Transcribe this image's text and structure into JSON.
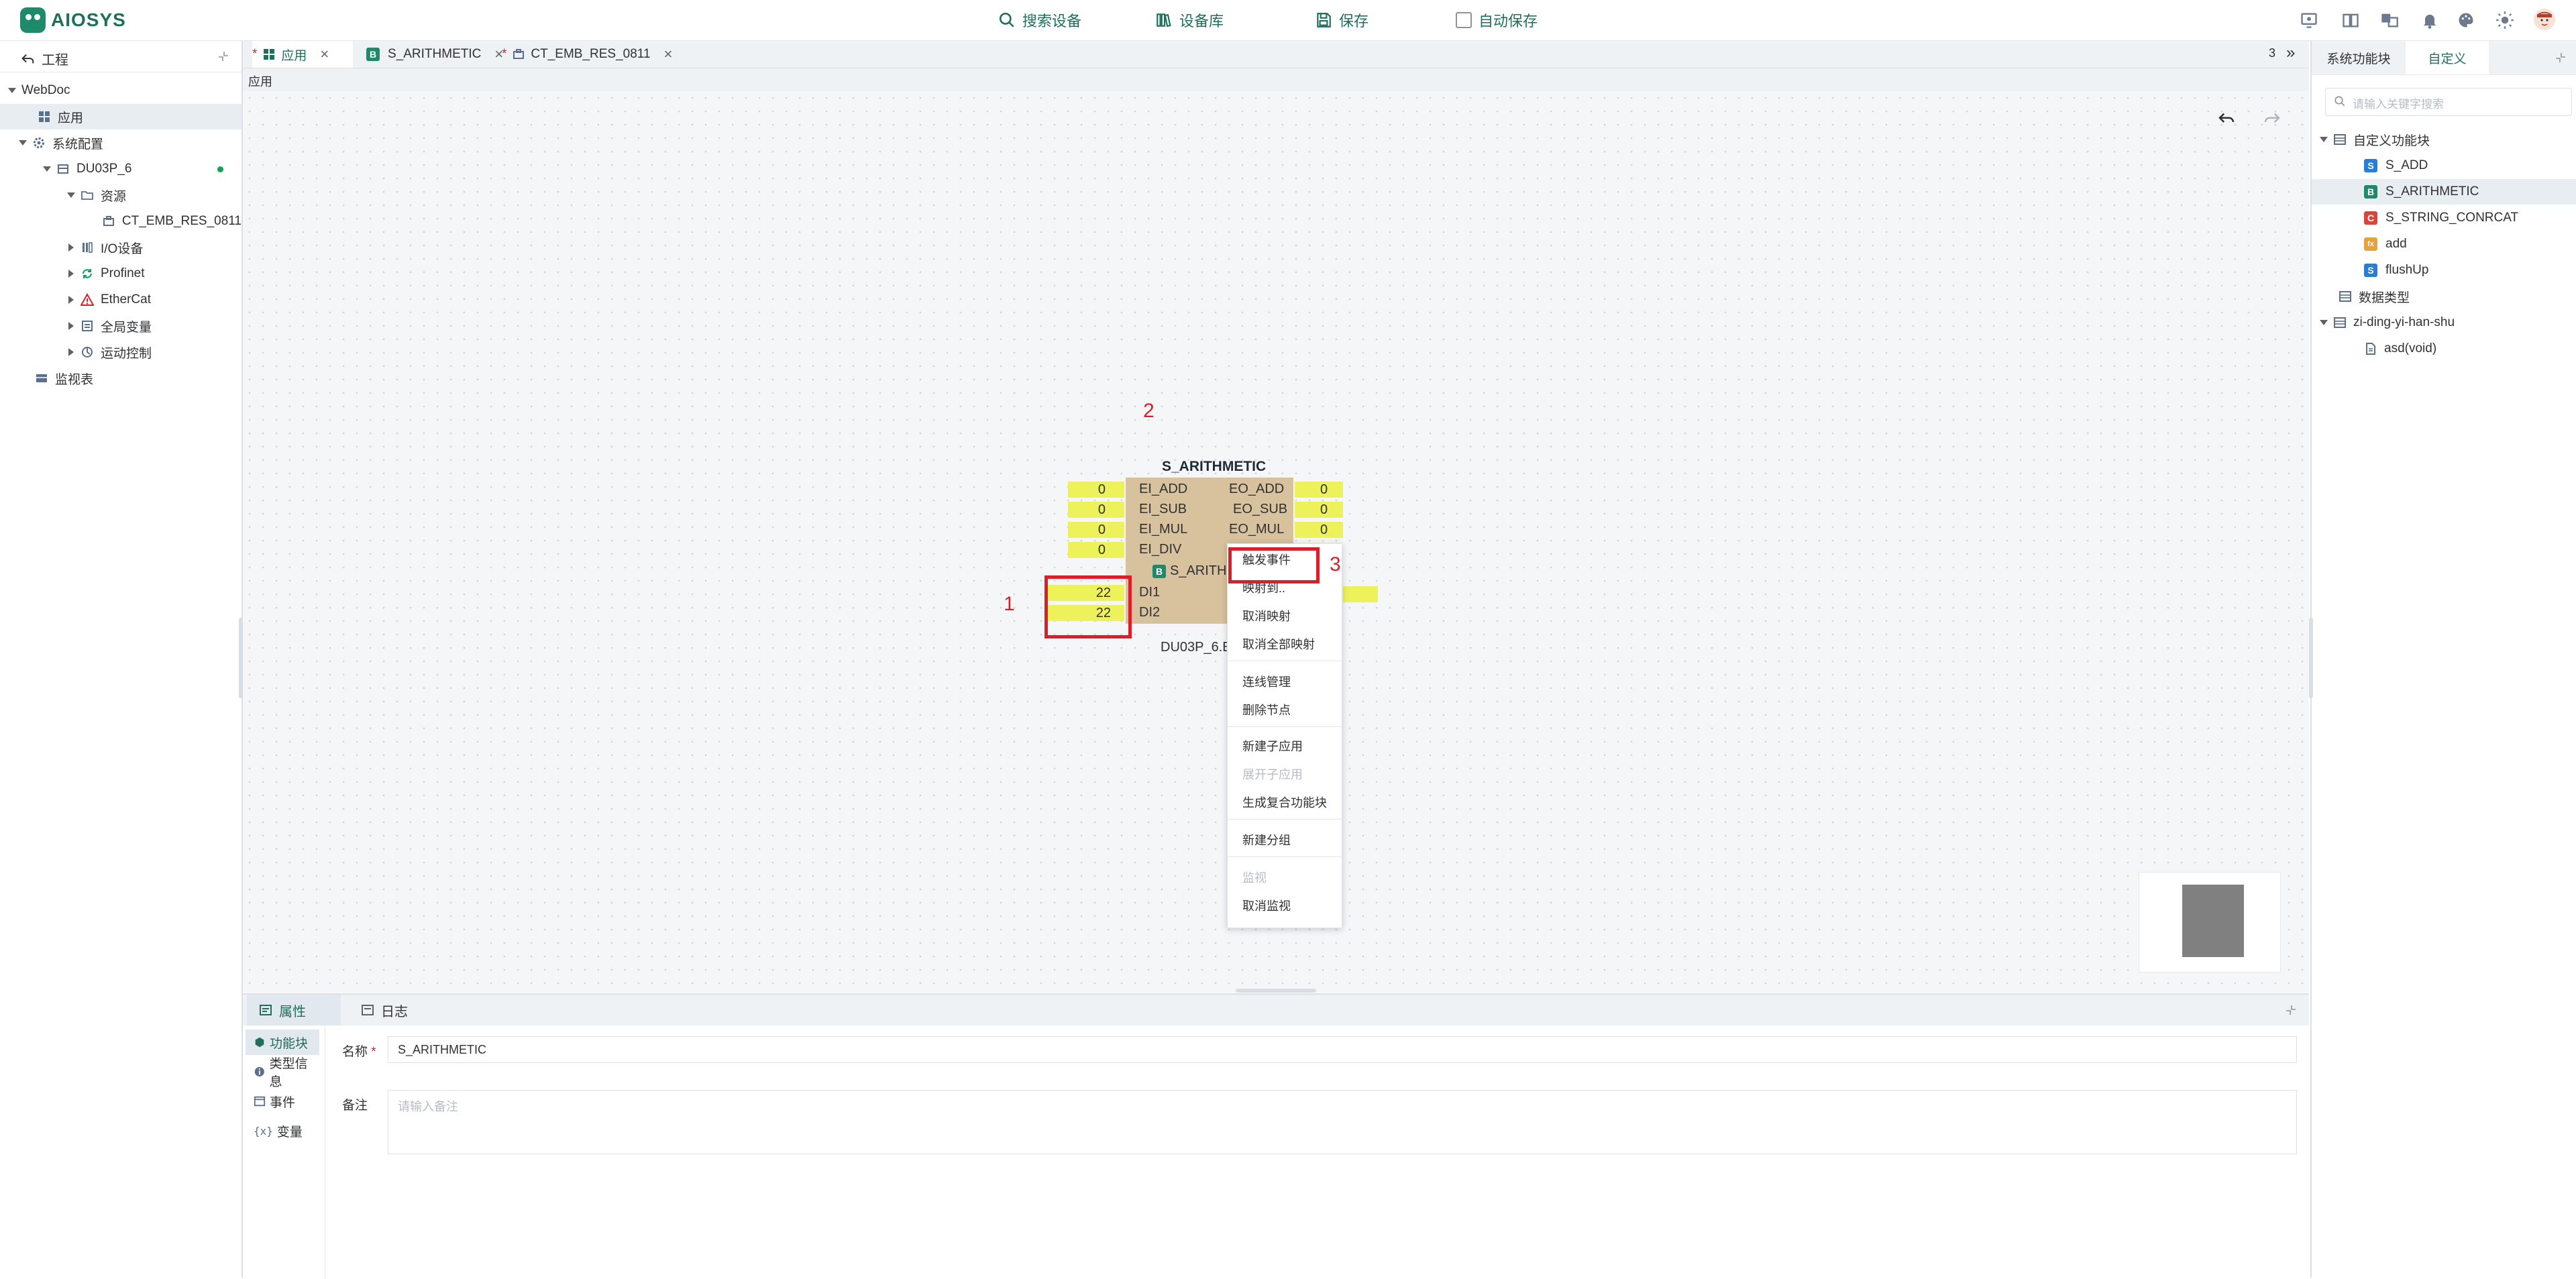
{
  "app": {
    "logo_text": "AIOSYS"
  },
  "toolbar": {
    "search_device": "搜索设备",
    "device_library": "设备库",
    "save": "保存",
    "auto_save": "自动保存"
  },
  "left": {
    "header": "工程",
    "tree": [
      {
        "label": "WebDoc"
      },
      {
        "label": "应用"
      },
      {
        "label": "系统配置"
      },
      {
        "label": "DU03P_6"
      },
      {
        "label": "资源"
      },
      {
        "label": "CT_EMB_RES_0811"
      },
      {
        "label": "I/O设备"
      },
      {
        "label": "Profinet"
      },
      {
        "label": "EtherCat"
      },
      {
        "label": "全局变量"
      },
      {
        "label": "运动控制"
      },
      {
        "label": "监视表"
      }
    ]
  },
  "tabs": [
    {
      "mark": "*",
      "label": "应用"
    },
    {
      "mark": "",
      "label": "S_ARITHMETIC"
    },
    {
      "mark": "*",
      "label": "CT_EMB_RES_0811"
    }
  ],
  "tabs_right": {
    "count": "3",
    "more": "»"
  },
  "breadcrumb": "应用",
  "canvas": {
    "fb_title": "S_ARITHMETIC",
    "fb_type_label": "S_ARITH",
    "device_label": "DU03P_6.E",
    "inputs_events": [
      {
        "value": "0",
        "label": "EI_ADD"
      },
      {
        "value": "0",
        "label": "EI_SUB"
      },
      {
        "value": "0",
        "label": "EI_MUL"
      },
      {
        "value": "0",
        "label": "EI_DIV"
      }
    ],
    "outputs_events": [
      {
        "label": "EO_ADD",
        "value": "0"
      },
      {
        "label": "EO_SUB",
        "value": "0"
      },
      {
        "label": "EO_MUL",
        "value": "0"
      }
    ],
    "data_inputs": [
      {
        "value": "22",
        "label": "DI1"
      },
      {
        "value": "22",
        "label": "DI2"
      }
    ],
    "annotations": {
      "n1": "1",
      "n2": "2",
      "n3": "3"
    }
  },
  "context_menu": {
    "items": [
      {
        "label": "触发事件",
        "disabled": false
      },
      {
        "label": "映射到..",
        "disabled": false
      },
      {
        "label": "取消映射",
        "disabled": false
      },
      {
        "label": "取消全部映射",
        "disabled": false
      },
      {
        "label": "连线管理",
        "disabled": false
      },
      {
        "label": "删除节点",
        "disabled": false
      },
      {
        "label": "新建子应用",
        "disabled": false
      },
      {
        "label": "展开子应用",
        "disabled": true
      },
      {
        "label": "生成复合功能块",
        "disabled": false
      },
      {
        "label": "新建分组",
        "disabled": false
      },
      {
        "label": "监视",
        "disabled": true
      },
      {
        "label": "取消监视",
        "disabled": false
      }
    ]
  },
  "bottom": {
    "tab_props": "属性",
    "tab_log": "日志",
    "side": [
      "功能块",
      "类型信息",
      "事件",
      "变量"
    ],
    "name_label": "名称",
    "required_mark": "*",
    "name_value": "S_ARITHMETIC",
    "note_label": "备注",
    "note_placeholder": "请输入备注"
  },
  "right": {
    "tab_system": "系统功能块",
    "tab_custom": "自定义",
    "search_placeholder": "请输入关键字搜索",
    "items": [
      {
        "label": "自定义功能块"
      },
      {
        "label": "S_ADD",
        "badge": "S"
      },
      {
        "label": "S_ARITHMETIC",
        "badge": "B"
      },
      {
        "label": "S_STRING_CONRCAT",
        "badge": "C"
      },
      {
        "label": "add",
        "badge": "fx"
      },
      {
        "label": "flushUp",
        "badge": "S"
      },
      {
        "label": "数据类型"
      },
      {
        "label": "zi-ding-yi-han-shu"
      },
      {
        "label": "asd(void)"
      }
    ]
  },
  "colors": {
    "brand": "#1f6f5a",
    "highlight": "#d9202a",
    "pin": "#eef25a",
    "fb_body": "#d8c29d"
  }
}
